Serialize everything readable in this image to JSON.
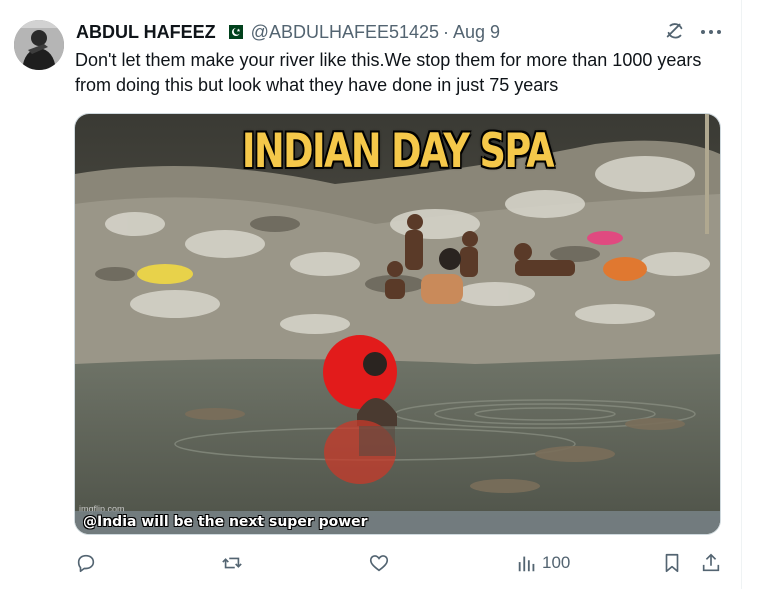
{
  "tweet": {
    "display_name": "ABDUL HAFEEZ",
    "handle": "@ABDULHAFEE51425",
    "separator": "·",
    "date": "Aug 9",
    "text": "Don't let them make your river like this.We stop them for more than  1000 years from doing this but look what they have done in just 75 years",
    "flag_icon": "pakistan-flag-icon"
  },
  "media": {
    "title": "INDIAN DAY SPA",
    "caption": "@India will be the next super power",
    "watermark": "imgflip.com"
  },
  "actions": {
    "reply_icon": "reply-icon",
    "retweet_icon": "retweet-icon",
    "like_icon": "heart-icon",
    "views_icon": "views-icon",
    "views_count": "100",
    "bookmark_icon": "bookmark-icon",
    "share_icon": "share-icon"
  },
  "colors": {
    "text_primary": "#0f1419",
    "text_secondary": "#536471",
    "title_yellow": "#f5c84a"
  }
}
